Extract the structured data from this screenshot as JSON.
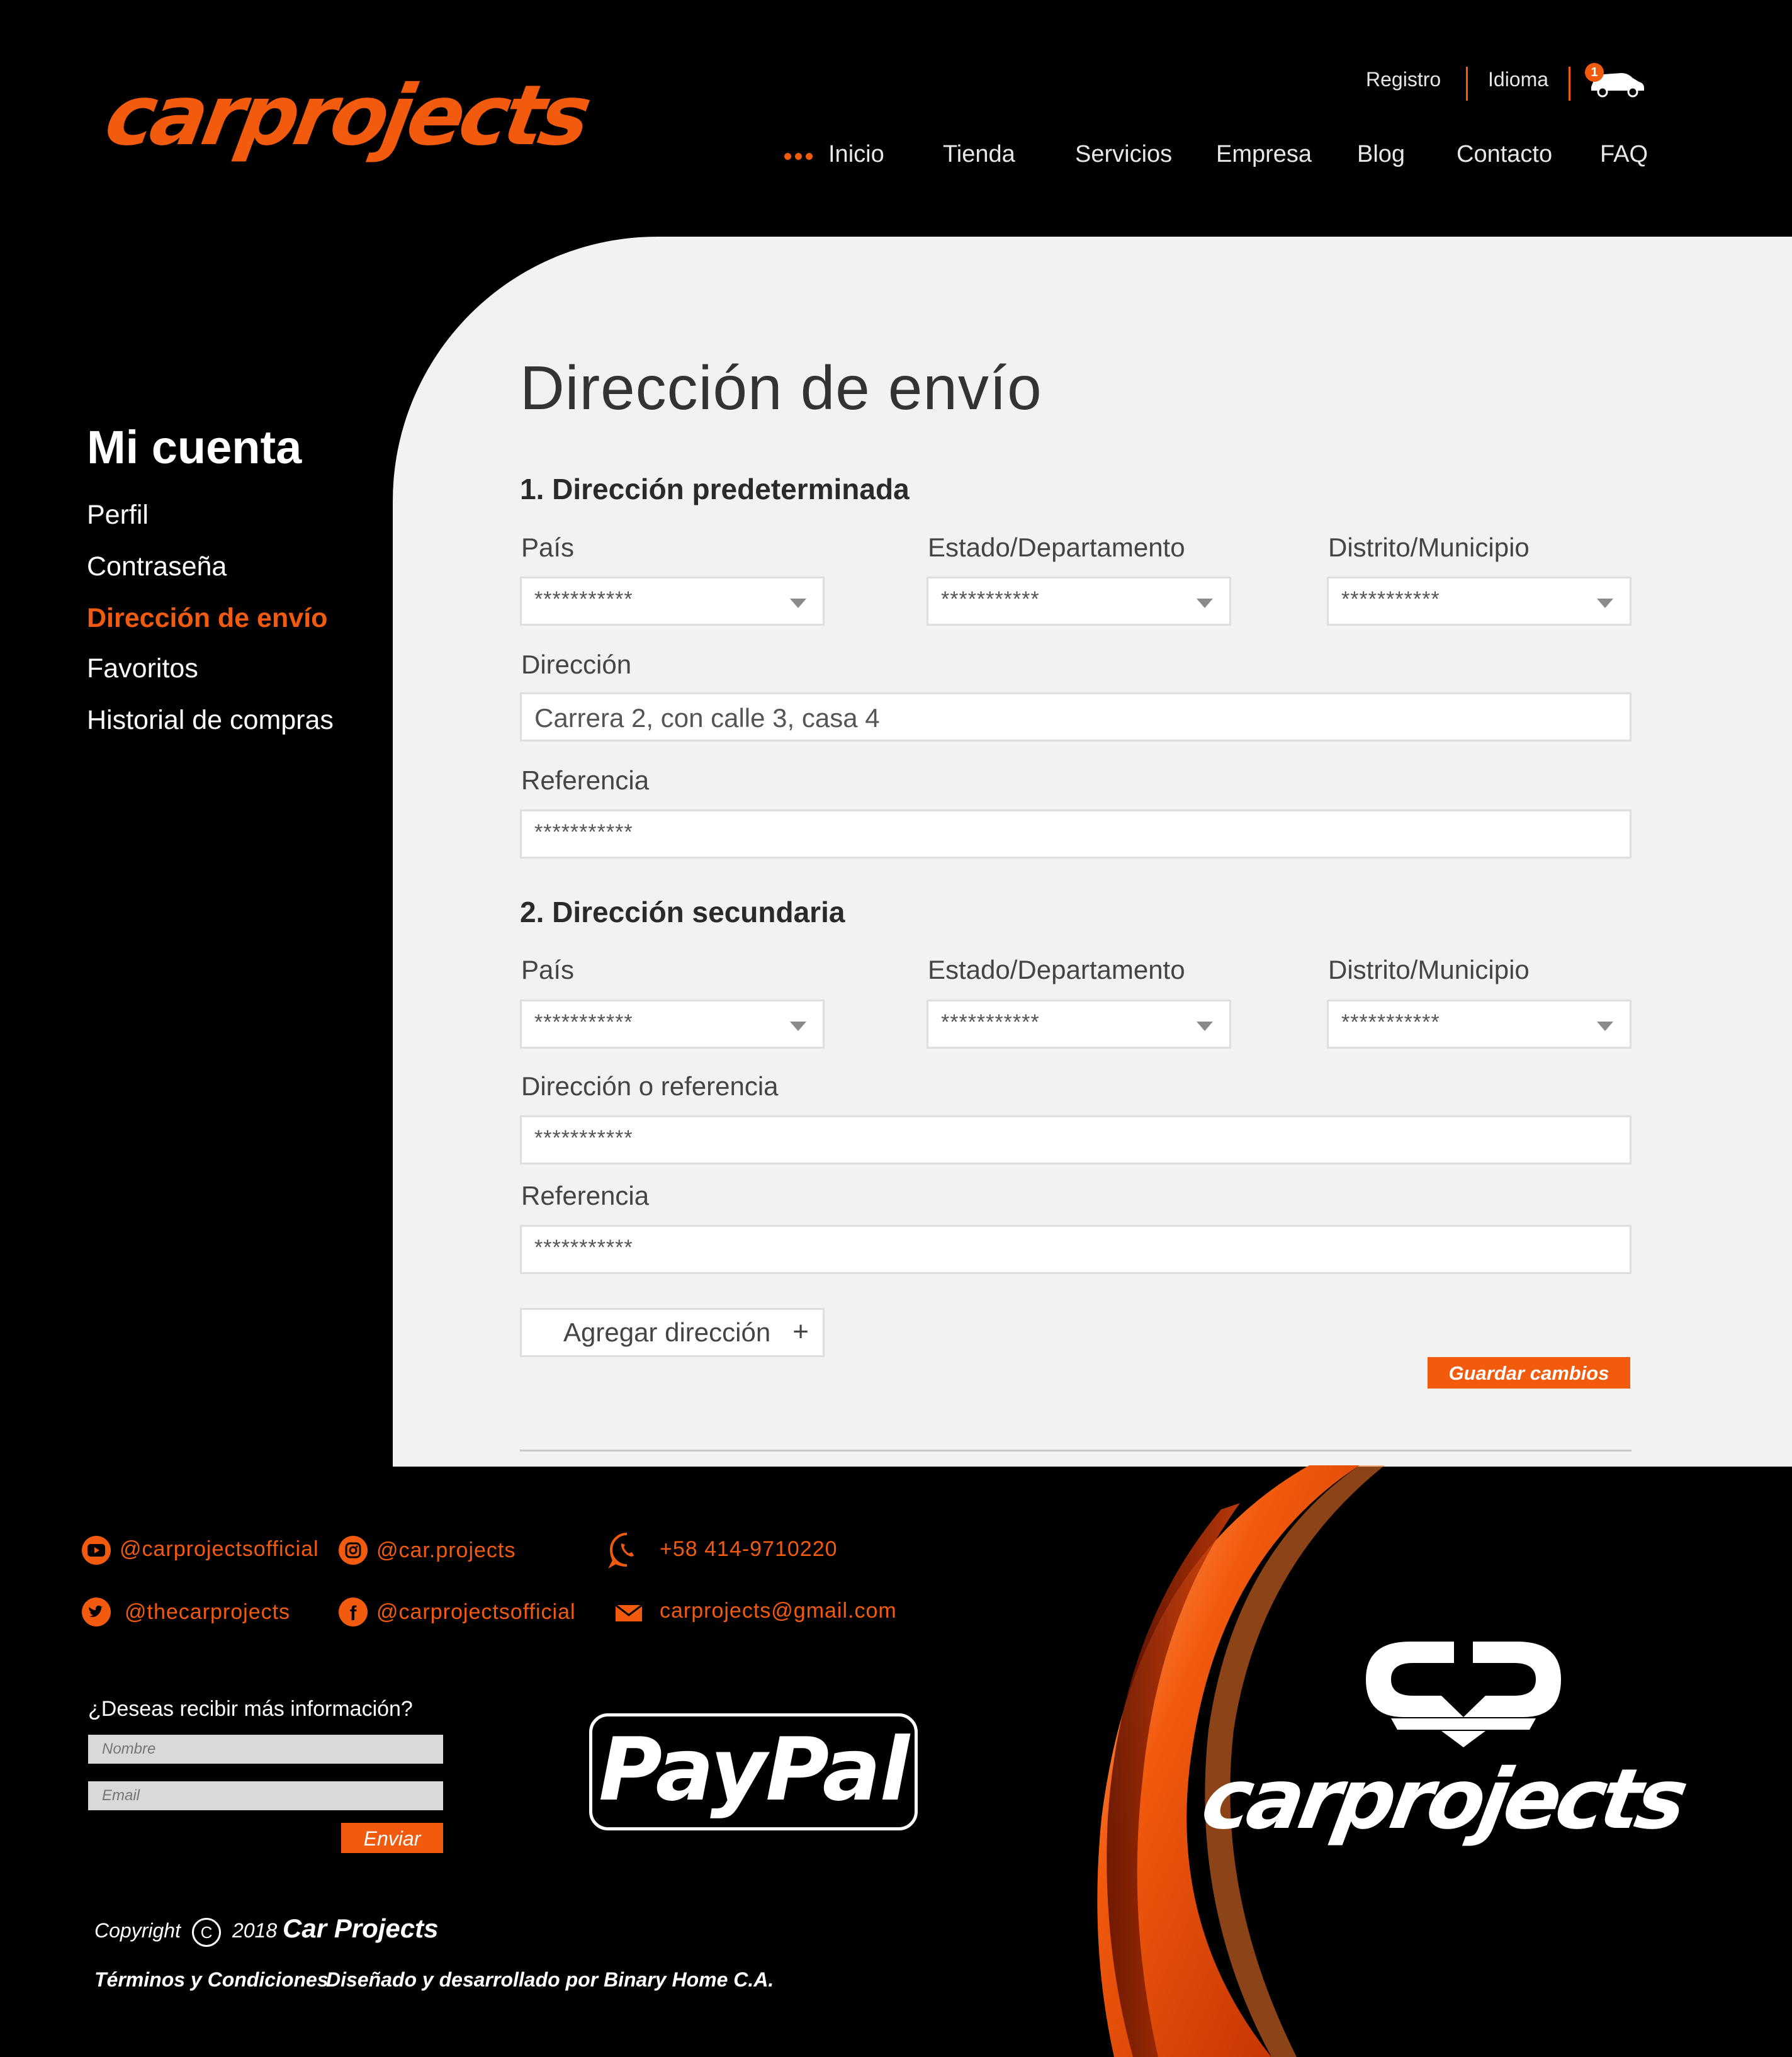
{
  "header": {
    "brand": "carprojects",
    "topbar": {
      "register": "Registro",
      "language": "Idioma",
      "cart_count": "1"
    },
    "nav": [
      {
        "label": "Inicio"
      },
      {
        "label": "Tienda"
      },
      {
        "label": "Servicios"
      },
      {
        "label": "Empresa"
      },
      {
        "label": "Blog"
      },
      {
        "label": "Contacto"
      },
      {
        "label": "FAQ"
      }
    ],
    "active_nav": "Inicio"
  },
  "sidebar": {
    "title": "Mi cuenta",
    "items": [
      {
        "label": "Perfil"
      },
      {
        "label": "Contraseña"
      },
      {
        "label": "Dirección de envío"
      },
      {
        "label": "Favoritos"
      },
      {
        "label": "Historial de compras"
      }
    ],
    "active": "Dirección de envío"
  },
  "main": {
    "title": "Dirección de envío",
    "primary": {
      "heading": "1. Dirección predeterminada",
      "country_label": "País",
      "country_value": "***********",
      "state_label": "Estado/Departamento",
      "state_value": "***********",
      "district_label": "Distrito/Municipio",
      "district_value": "***********",
      "address_label": "Dirección",
      "address_value": "Carrera 2, con calle 3, casa 4",
      "reference_label": "Referencia",
      "reference_value": "***********"
    },
    "secondary": {
      "heading": "2. Dirección secundaria",
      "country_label": "País",
      "country_value": "***********",
      "state_label": "Estado/Departamento",
      "state_value": "***********",
      "district_label": "Distrito/Municipio",
      "district_value": "***********",
      "address_label": "Dirección o referencia",
      "address_value": "***********",
      "reference_label": "Referencia",
      "reference_value": "***********"
    },
    "add_address_label": "Agregar dirección",
    "add_address_symbol": "+",
    "save_label": "Guardar cambios"
  },
  "footer": {
    "social": {
      "youtube": "@carprojectsofficial",
      "instagram": "@car.projects",
      "whatsapp": "+58 414-9710220",
      "twitter": "@thecarprojects",
      "facebook": "@carprojectsofficial",
      "email": "carprojects@gmail.com"
    },
    "newsletter": {
      "question": "¿Deseas recibir más información?",
      "name_placeholder": "Nombre",
      "email_placeholder": "Email",
      "send_label": "Enviar"
    },
    "payment": "PayPal",
    "brand": "carprojects",
    "copyright": {
      "label": "Copyright",
      "symbol": "C",
      "year": "2018",
      "brand": "Car Projects"
    },
    "terms": "Términos y Condiciones",
    "credits": "Diseñado y desarrollado por Binary Home C.A."
  },
  "colors": {
    "accent": "#f25a0d",
    "background": "#000000",
    "panel": "#f2f2f2"
  }
}
